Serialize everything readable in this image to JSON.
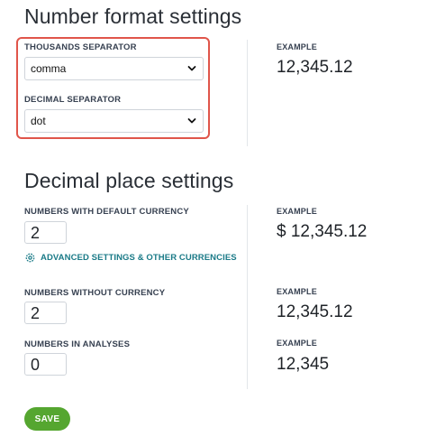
{
  "number_format": {
    "title": "Number format settings",
    "thousands_label": "THOUSANDS SEPARATOR",
    "thousands_value": "comma",
    "decimal_label": "DECIMAL SEPARATOR",
    "decimal_value": "dot",
    "example_label": "EXAMPLE",
    "example_value": "12,345.12"
  },
  "decimal_places": {
    "title": "Decimal place settings",
    "default_currency_label": "NUMBERS WITH DEFAULT CURRENCY",
    "default_currency_value": "2",
    "default_currency_example_label": "EXAMPLE",
    "default_currency_example": "$ 12,345.12",
    "advanced_link": "ADVANCED SETTINGS & OTHER CURRENCIES",
    "without_currency_label": "NUMBERS WITHOUT CURRENCY",
    "without_currency_value": "2",
    "without_currency_example_label": "EXAMPLE",
    "without_currency_example": "12,345.12",
    "analyses_label": "NUMBERS IN ANALYSES",
    "analyses_value": "0",
    "analyses_example_label": "EXAMPLE",
    "analyses_example": "12,345"
  },
  "actions": {
    "save_label": "SAVE"
  },
  "colors": {
    "highlight": "#e0554a",
    "link": "#1a7a87",
    "save_button": "#55a630"
  },
  "icons": {
    "select_arrow": "chevron-down-icon",
    "advanced": "gear-icon"
  }
}
